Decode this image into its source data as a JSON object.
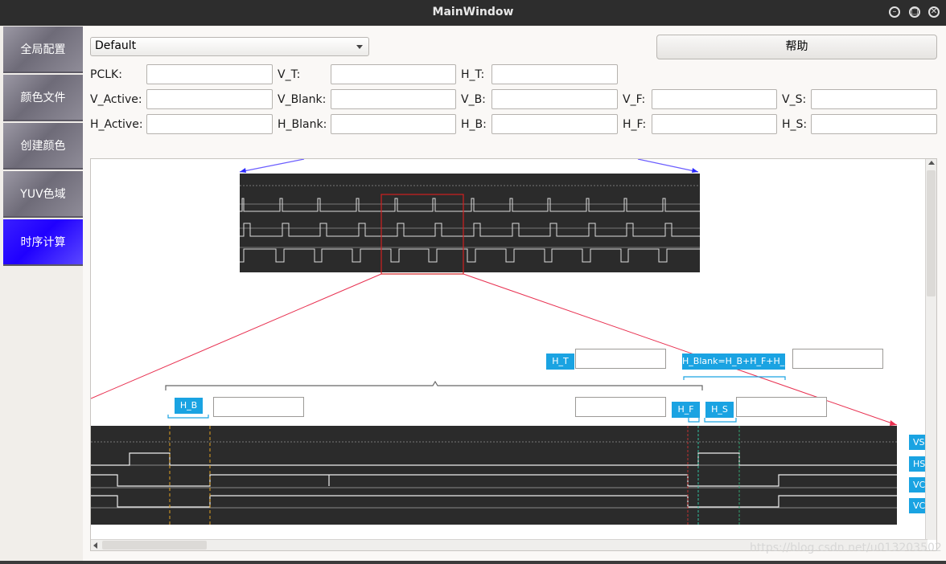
{
  "window": {
    "title": "MainWindow"
  },
  "sidebar": {
    "items": [
      {
        "label": "全局配置"
      },
      {
        "label": "颜色文件"
      },
      {
        "label": "创建颜色"
      },
      {
        "label": "YUV色域"
      },
      {
        "label": "时序计算",
        "active": true
      }
    ]
  },
  "preset": {
    "selected": "Default"
  },
  "help_button": "帮助",
  "fields": {
    "pclk": "PCLK:",
    "v_t": "V_T:",
    "h_t": "H_T:",
    "v_active": "V_Active:",
    "v_blank": "V_Blank:",
    "v_b": "V_B:",
    "v_f": "V_F:",
    "v_s": "V_S:",
    "h_active": "H_Active:",
    "h_blank": "H_Blank:",
    "h_b": "H_B:",
    "h_f": "H_F:",
    "h_s": "H_S:"
  },
  "diagram": {
    "tags": {
      "h_t": "H_T",
      "h_blank": "H_Blank=H_B+H_F+H_S",
      "h_b": "H_B",
      "h_f": "H_F",
      "h_s": "H_S",
      "vs": "VS",
      "hs": "HS",
      "vc1": "VC",
      "vc2": "VC"
    }
  },
  "watermark": "https://blog.csdn.net/u013203502",
  "colors": {
    "accent_active": "#2000ff",
    "tag_blue": "#1aa3e2",
    "scope_bg": "#2b2b2b"
  }
}
